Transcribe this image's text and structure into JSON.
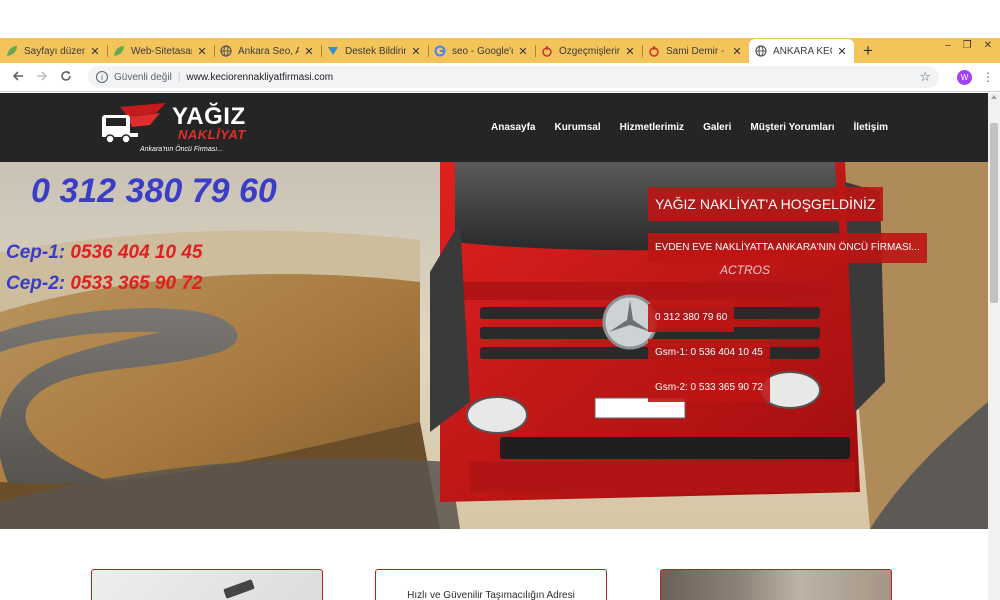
{
  "browser": {
    "tabs": [
      {
        "title": "Sayfayı düzenle",
        "icon": "leaf-icon",
        "active": false
      },
      {
        "title": "Web-Sitetasarım",
        "icon": "leaf-icon",
        "active": false
      },
      {
        "title": "Ankara Seo, An",
        "icon": "globe-icon",
        "active": false
      },
      {
        "title": "Destek Bildirim",
        "icon": "support-icon",
        "active": false
      },
      {
        "title": "seo - Google'd",
        "icon": "google-icon",
        "active": false
      },
      {
        "title": "Özgeçmişlerim",
        "icon": "hand-icon",
        "active": false
      },
      {
        "title": "Sami Demir - Ö",
        "icon": "hand-icon",
        "active": false
      },
      {
        "title": "ANKARA KEÇİÖ",
        "icon": "globe-icon",
        "active": true
      }
    ],
    "close_glyph": "✕",
    "new_tab_glyph": "+",
    "window_controls": {
      "minimize": "–",
      "maximize": "❐",
      "close": "✕"
    },
    "security_label": "Güvenli değil",
    "url": "www.keciorennakliyatfirmasi.com",
    "profile_initial": "W",
    "colors": {
      "tabstrip": "#f2c45a",
      "profile": "#a142f4"
    }
  },
  "site": {
    "brand": "YAĞIZ",
    "brand_sub": "NAKLİYAT",
    "tagline": "Ankara'nın Öncü Firması...",
    "nav": [
      "Anasayfa",
      "Kurumsal",
      "Hizmetlerimiz",
      "Galeri",
      "Müşteri Yorumları",
      "İletişim"
    ],
    "colors": {
      "header": "#252525",
      "accent": "#c41c1c",
      "phone_blue": "#3a3dc7",
      "phone_red": "#e02020"
    }
  },
  "hero": {
    "phone": "0 312 380 79 60",
    "cep1_label": "Cep-1:",
    "cep1_number": "0536 404 10 45",
    "cep2_label": "Cep-2:",
    "cep2_number": "0533 365 90 72",
    "welcome": "YAĞIZ NAKLİYAT'A HOŞGELDİNİZ",
    "slogan": "EVDEN EVE NAKLİYATTA ANKARA'NIN ÖNCÜ FİRMASI...",
    "badge_phone": "0 312 380 79 60",
    "badge_gsm1": "Gsm-1: 0 536 404 10 45",
    "badge_gsm2": "Gsm-2: 0 533 365 90 72",
    "truck_grille_text": "ACTROS"
  },
  "cards": [
    {
      "text": ""
    },
    {
      "text": "Hızlı ve Güvenilir  Taşımacılığın Adresi"
    },
    {
      "text": ""
    }
  ]
}
